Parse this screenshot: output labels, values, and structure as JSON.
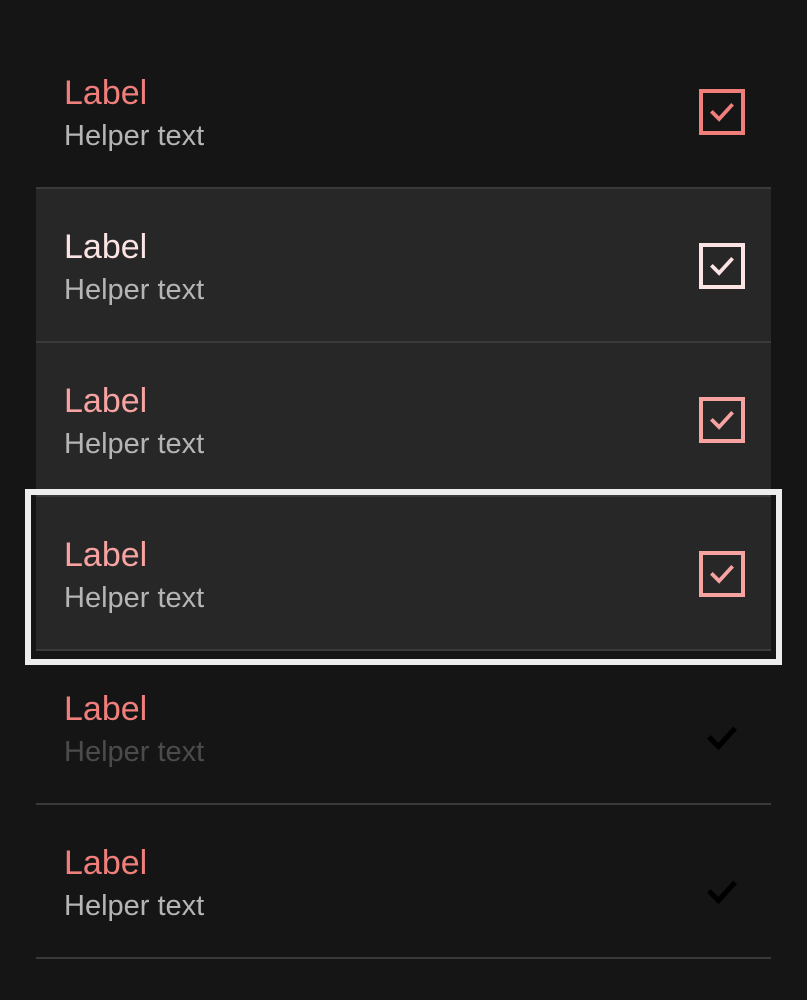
{
  "list": {
    "items": [
      {
        "label": "Label",
        "helper": "Helper text",
        "checked": true,
        "state": "default",
        "check_color": "#f07f7c"
      },
      {
        "label": "Label",
        "helper": "Helper text",
        "checked": true,
        "state": "hover",
        "check_color": "#fbe4e3"
      },
      {
        "label": "Label",
        "helper": "Helper text",
        "checked": true,
        "state": "pressed",
        "check_color": "#f6a3a2"
      },
      {
        "label": "Label",
        "helper": "Helper text",
        "checked": true,
        "state": "focused",
        "check_color": "#f6a3a2"
      },
      {
        "label": "Label",
        "helper": "Helper text",
        "checked": true,
        "state": "disabled",
        "check_color": "#000000"
      },
      {
        "label": "Label",
        "helper": "Helper text",
        "checked": true,
        "state": "checkmark-only",
        "check_color": "#000000"
      }
    ]
  },
  "colors": {
    "background": "#151515",
    "row_filled": "#272727",
    "accent": "#f07f7c",
    "helper": "#b5b5b5",
    "divider": "#3a3a3a",
    "focus_ring": "#ededed"
  },
  "icons": {
    "checkbox": "checkbox-checked-icon",
    "checkmark": "checkmark-icon"
  }
}
